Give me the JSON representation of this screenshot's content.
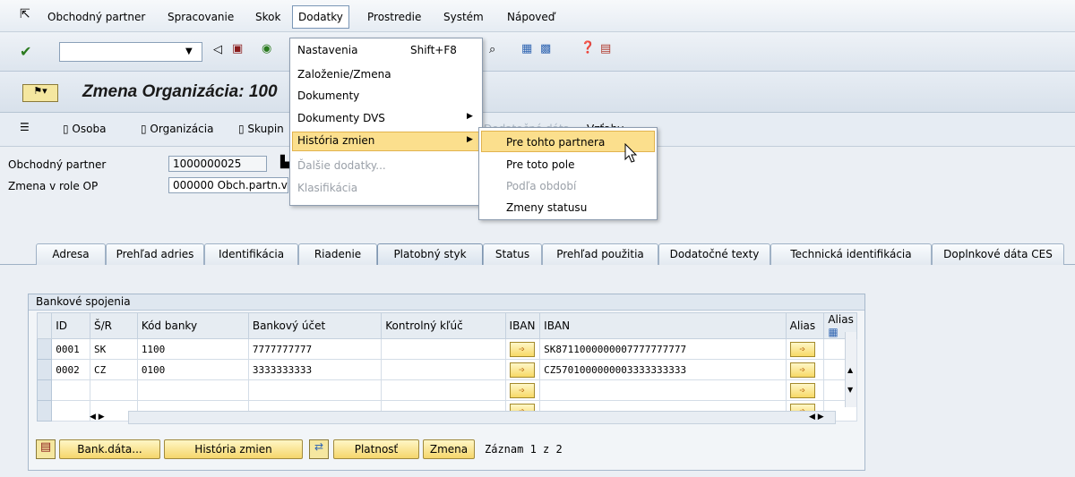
{
  "menubar": {
    "items": [
      "Obchodný partner",
      "Spracovanie",
      "Skok",
      "Dodatky",
      "Prostredie",
      "Systém",
      "Nápoveď"
    ]
  },
  "toolbar": {
    "command_value": ""
  },
  "title": "Zmena Organizácia: 100",
  "appbar": {
    "items": [
      "Osoba",
      "Organizácia",
      "Skupin"
    ],
    "faded": "Dodatočné dáta",
    "vztahy": "Vzťahy"
  },
  "form": {
    "partner_label": "Obchodný partner",
    "partner_value": "1000000025",
    "role_label": "Zmena v role OP",
    "role_value": "000000 Obch.partn.v"
  },
  "tabs": [
    "Adresa",
    "Prehľad adries",
    "Identifikácia",
    "Riadenie",
    "Platobný styk",
    "Status",
    "Prehľad použitia",
    "Dodatočné texty",
    "Technická identifikácia",
    "Doplnkové dáta CES"
  ],
  "active_tab": "Platobný styk",
  "bank": {
    "panel_title": "Bankové spojenia",
    "columns": [
      "ID",
      "Š/R",
      "Kód banky",
      "Bankový účet",
      "Kontrolný kľúč",
      "IBAN",
      "IBAN",
      "Alias",
      "Alias"
    ],
    "rows": [
      {
        "id": "0001",
        "country": "SK",
        "bank_code": "1100",
        "account": "7777777777",
        "check_key": "",
        "iban": "SK8711000000007777777777",
        "alias": ""
      },
      {
        "id": "0002",
        "country": "CZ",
        "bank_code": "0100",
        "account": "3333333333",
        "check_key": "",
        "iban": "CZ5701000000003333333333",
        "alias": ""
      }
    ],
    "buttons": {
      "bank_data": "Bank.dáta...",
      "history": "História zmien",
      "validity": "Platnosť",
      "change": "Zmena"
    },
    "record_info": "Záznam 1 z 2"
  },
  "dodatky_menu": {
    "items": [
      {
        "label": "Nastavenia",
        "shortcut": "Shift+F8",
        "enabled": true
      },
      {
        "label": "Založenie/Zmena",
        "enabled": true
      },
      {
        "label": "Dokumenty",
        "enabled": true
      },
      {
        "label": "Dokumenty DVS",
        "enabled": true,
        "submenu": true
      },
      {
        "label": "História zmien",
        "enabled": true,
        "submenu": true,
        "highlighted": true
      },
      {
        "label": "Ďalšie dodatky...",
        "enabled": false
      },
      {
        "label": "Klasifikácia",
        "enabled": false
      }
    ]
  },
  "history_submenu": {
    "items": [
      {
        "label": "Pre tohto partnera",
        "enabled": true,
        "highlighted": true
      },
      {
        "label": "Pre toto pole",
        "enabled": true
      },
      {
        "label": "Podľa období",
        "enabled": false
      },
      {
        "label": "Zmeny statusu",
        "enabled": true
      }
    ]
  },
  "colors": {
    "highlight": "#fbdf8d",
    "button": "#f5d66b",
    "panel": "#dfe7f0"
  }
}
